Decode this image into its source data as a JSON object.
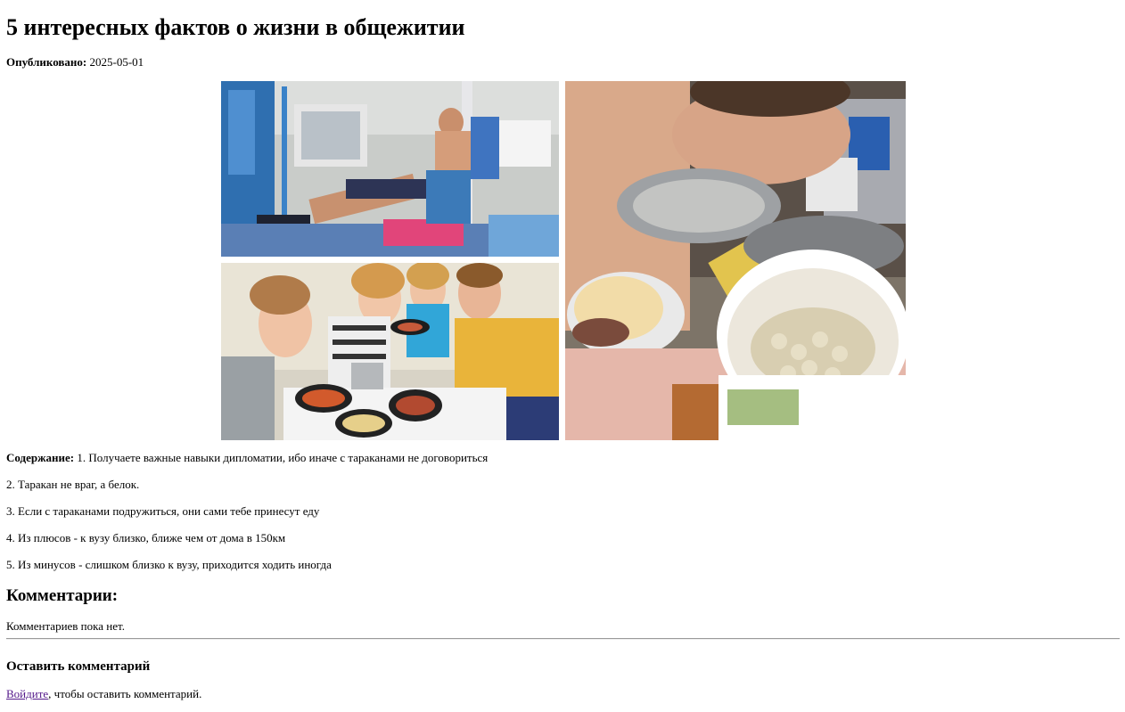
{
  "article": {
    "title": "5 интересных фактов о жизни в общежитии",
    "published_label": "Опубликовано:",
    "published_date": "2025-05-01",
    "content_label": "Содержание:",
    "facts": [
      "1. Получаете важные навыки дипломатии, ибо иначе с тараканами не договориться",
      "2. Таракан не враг, а белок.",
      "3. Если с тараканами подружиться, они сами тебе принесут еду",
      "4. Из плюсов - к вузу близко, ближе чем от дома в 150км",
      "5. Из минусов - слишком близко к вузу, приходится ходить иногда"
    ]
  },
  "comments": {
    "heading": "Комментарии:",
    "empty_text": "Комментариев пока нет."
  },
  "comment_form": {
    "heading": "Оставить комментарий",
    "login_link": "Войдите",
    "login_suffix": ", чтобы оставить комментарий."
  }
}
